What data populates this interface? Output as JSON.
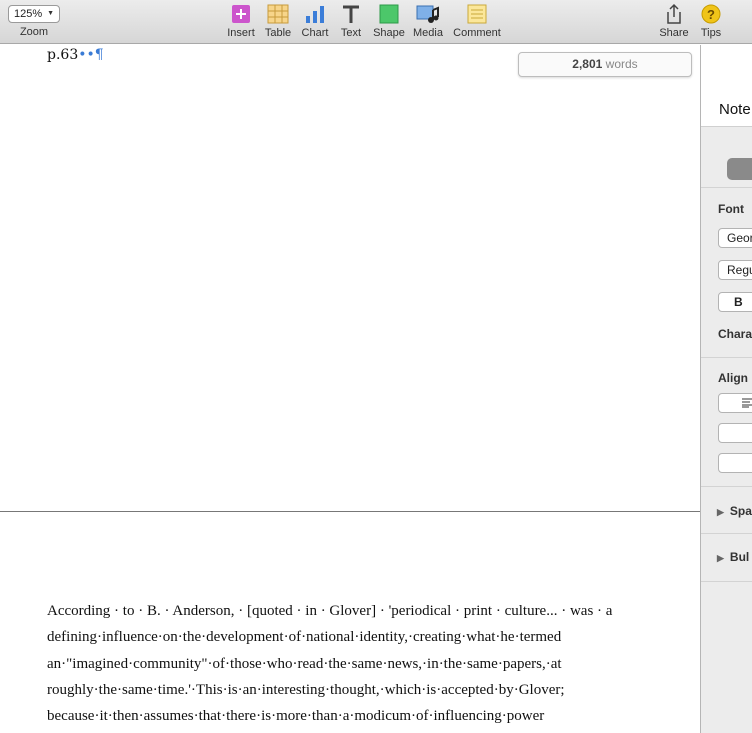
{
  "toolbar": {
    "zoom_value": "125%",
    "zoom_label": "Zoom",
    "insert_label": "Insert",
    "table_label": "Table",
    "chart_label": "Chart",
    "text_label": "Text",
    "shape_label": "Shape",
    "media_label": "Media",
    "comment_label": "Comment",
    "share_label": "Share",
    "tips_label": "Tips"
  },
  "document": {
    "page_ref": "p.63",
    "word_count_number": "2,801",
    "word_count_unit": "words",
    "body_lines": [
      "According · to · B. · Anderson, · [quoted · in · Glover] · 'periodical · print · culture... · was · a",
      "defining·influence·on·the·development·of·national·identity,·creating·what·he·termed",
      "an·\"imagined·community\"·of·those·who·read·the·same·news,·in·the·same·papers,·at",
      "roughly·the·same·time.'·This·is·an·interesting·thought,·which·is·accepted·by·Glover;",
      "because·it·then·assumes·that·there·is·more·than·a·modicum·of·influencing·power"
    ]
  },
  "sidebar": {
    "notes_title": "Note",
    "font_heading": "Font",
    "font_family": "Geor",
    "font_style": "Regu",
    "bold_label": "B",
    "character_heading": "Chara",
    "alignment_heading": "Align",
    "spacing_label": "Spa",
    "bullets_label": "Bul"
  },
  "colors": {
    "insert_icon": "#cc55cc",
    "chart_icon": "#3b7dd8",
    "shape_icon": "#4cc76a",
    "tips_icon": "#f0c419",
    "invisibles": "#3a7bd5"
  }
}
